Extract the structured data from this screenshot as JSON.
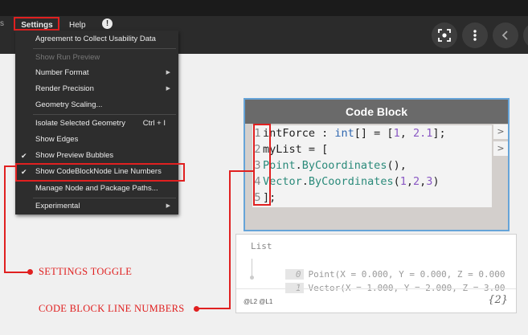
{
  "menubar": {
    "left_stub": "s",
    "settings": "Settings",
    "help": "Help",
    "info": "!"
  },
  "toolbar_icons": [
    "focus-icon",
    "more-icon",
    "back-icon",
    "next-icon"
  ],
  "dropdown": {
    "items": [
      {
        "label": "Agreement to Collect Usability Data"
      },
      {
        "label": "Show Run Preview",
        "disabled": true
      },
      {
        "label": "Number Format",
        "submenu": true
      },
      {
        "label": "Render Precision",
        "submenu": true
      },
      {
        "label": "Geometry Scaling..."
      },
      {
        "label": "Isolate Selected Geometry",
        "shortcut": "Ctrl + I"
      },
      {
        "label": "Show Edges"
      },
      {
        "label": "Show Preview Bubbles",
        "checked": true
      },
      {
        "label": "Show CodeBlockNode Line Numbers",
        "checked": true
      },
      {
        "label": "Manage Node and Package Paths..."
      },
      {
        "label": "Experimental",
        "submenu": true
      }
    ]
  },
  "node": {
    "title": "Code Block",
    "lines": [
      {
        "n": "1",
        "tokens": [
          [
            "plain",
            "intForce : "
          ],
          [
            "kw",
            "int"
          ],
          [
            "plain",
            "[] = ["
          ],
          [
            "num",
            "1"
          ],
          [
            "plain",
            ", "
          ],
          [
            "num",
            "2.1"
          ],
          [
            "plain",
            "];"
          ]
        ]
      },
      {
        "n": "2",
        "tokens": [
          [
            "plain",
            "myList = ["
          ]
        ]
      },
      {
        "n": "3",
        "tokens": [
          [
            "func",
            "Point"
          ],
          [
            "plain",
            "."
          ],
          [
            "func",
            "ByCoordinates"
          ],
          [
            "plain",
            "(),"
          ]
        ]
      },
      {
        "n": "4",
        "tokens": [
          [
            "func",
            "Vector"
          ],
          [
            "plain",
            "."
          ],
          [
            "func",
            "ByCoordinates"
          ],
          [
            "plain",
            "("
          ],
          [
            "num",
            "1"
          ],
          [
            "plain",
            ","
          ],
          [
            "num",
            "2"
          ],
          [
            "plain",
            ","
          ],
          [
            "num",
            "3"
          ],
          [
            "plain",
            ")"
          ]
        ]
      },
      {
        "n": "5",
        "tokens": [
          [
            "plain",
            "];"
          ]
        ]
      }
    ],
    "port_label": ">"
  },
  "preview": {
    "title": "List",
    "rows": [
      {
        "index": "0",
        "value": "Point(X = 0.000, Y = 0.000, Z = 0.000"
      },
      {
        "index": "1",
        "value": "Vector(X = 1.000, Y = 2.000, Z = 3.00"
      }
    ],
    "levels": "@L2 @L1",
    "count": "{2}"
  },
  "annotations": {
    "settings_toggle": "SETTINGS TOGGLE",
    "line_numbers": "CODE BLOCK LINE NUMBERS"
  },
  "colors": {
    "highlight": "#e02020",
    "node_border": "#66a4d8"
  }
}
